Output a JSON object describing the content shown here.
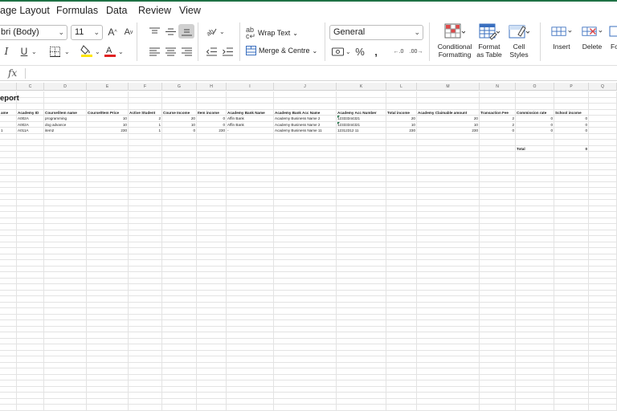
{
  "menu": {
    "tabs": [
      "age Layout",
      "Formulas",
      "Data",
      "Review",
      "View"
    ]
  },
  "ribbon": {
    "font_name": "bri (Body)",
    "font_size": "11",
    "number_format": "General",
    "wrap_text_label": "Wrap Text",
    "merge_label": "Merge & Centre",
    "conditional_formatting_label": [
      "Conditional",
      "Formatting"
    ],
    "format_as_table_label": [
      "Format",
      "as Table"
    ],
    "cell_styles_label": [
      "Cell",
      "Styles"
    ],
    "insert_label": "Insert",
    "delete_label": "Delete",
    "format_label_partial": "Fo",
    "accent_color": "#1e7145",
    "font_color_bar": "#e02020",
    "highlight_color_bar": "#ffe600"
  },
  "formula_bar": {
    "fx_label": "fx",
    "value": ""
  },
  "sheet": {
    "column_headers": [
      "",
      "C",
      "D",
      "E",
      "F",
      "G",
      "H",
      "I",
      "J",
      "K",
      "L",
      "M",
      "N",
      "O",
      "P",
      "Q"
    ],
    "title": "eport",
    "table_headers": [
      "ame",
      "Academy ID",
      "Course/item name",
      "Course/Item Price",
      "Active Student",
      "Course Income",
      "Item income",
      "Academy Bank Name",
      "Academy Bank Acc Name",
      "Academy Acc Number",
      "Total income",
      "Academy Claimable amount",
      "Transaction Fee",
      "Commission rate",
      "School income"
    ],
    "rows": [
      [
        "",
        "A002A",
        "programming",
        "10",
        "2",
        "20",
        "0",
        "Affin Bank",
        "Academy Business Name 2",
        "12333344321",
        "20",
        "20",
        "2",
        "0",
        "0"
      ],
      [
        "",
        "A002A",
        "dog advance",
        "10",
        "1",
        "10",
        "0",
        "Affin Bank",
        "Academy Business Name 2",
        "12333344321",
        "10",
        "10",
        "2",
        "0",
        "0"
      ],
      [
        "1",
        "A011A",
        "item2",
        "230",
        "1",
        "0",
        "230",
        "-",
        "Academy Business Name 11",
        "12312312 11",
        "230",
        "230",
        "0",
        "0",
        "0"
      ]
    ],
    "total_label": "Total",
    "total_value": "0"
  }
}
